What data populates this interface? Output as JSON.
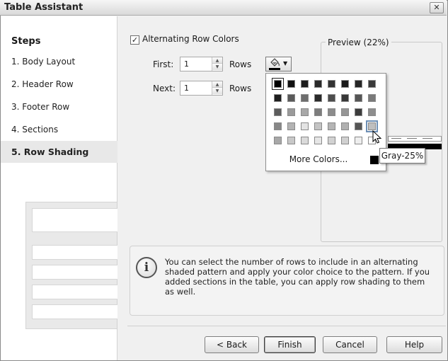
{
  "window": {
    "title": "Table Assistant",
    "close_glyph": "✕"
  },
  "steps": {
    "heading": "Steps",
    "items": [
      {
        "label": "1. Body Layout"
      },
      {
        "label": "2. Header Row"
      },
      {
        "label": "3. Footer Row"
      },
      {
        "label": "4. Sections"
      },
      {
        "label": "5. Row Shading",
        "active": true
      }
    ]
  },
  "shading": {
    "checkbox_label": "Alternating Row Colors",
    "checked": true,
    "check_glyph": "✓",
    "first_label": "First:",
    "first_value": "1",
    "next_label": "Next:",
    "next_value": "1",
    "rows_unit": "Rows",
    "fill_icon": "paint-bucket-icon"
  },
  "preview": {
    "label": "Preview (22%)"
  },
  "palette": {
    "more_colors_label": "More Colors...",
    "tooltip": "Gray-25%",
    "rows": [
      [
        "#000000",
        "#111111",
        "#1c1c1c",
        "#2a2a2a",
        "#333333",
        "#1a1a1a",
        "#262626",
        "#3a3a3a"
      ],
      [
        "#1e1e1e",
        "#5a5a5a",
        "#6e6e6e",
        "#2a2a2a",
        "#4d4d4d",
        "#383838",
        "#555555",
        "#7a7a7a"
      ],
      [
        "#5c5c5c",
        "#9a9a9a",
        "#a8a8a8",
        "#7d7d7d",
        "#8c8c8c",
        "#969696",
        "#3c3c3c",
        "#8e8e8e"
      ],
      [
        "#888888",
        "#b3b3b3",
        "#e3e3e3",
        "#c4c4c4",
        "#b5b5b5",
        "#b0b0b0",
        "#555555",
        "#bfbfbf"
      ],
      [
        "#a8a8a8",
        "#c8c8c8",
        "#dadada",
        "#e6e6e6",
        "#d2d2d2",
        "#d0d0d0",
        "#eeeeee",
        "#ffffff"
      ]
    ],
    "selected": "#000000",
    "hovered": "#bfbfbf"
  },
  "info": {
    "icon": "info-icon",
    "glyph": "i",
    "text": "You can select the number of rows to include in an alternating shaded pattern and apply your color choice to the pattern. If you added sections in the table, you can apply row shading to them as well."
  },
  "buttons": {
    "back": "< Back",
    "finish": "Finish",
    "cancel": "Cancel",
    "help": "Help"
  }
}
